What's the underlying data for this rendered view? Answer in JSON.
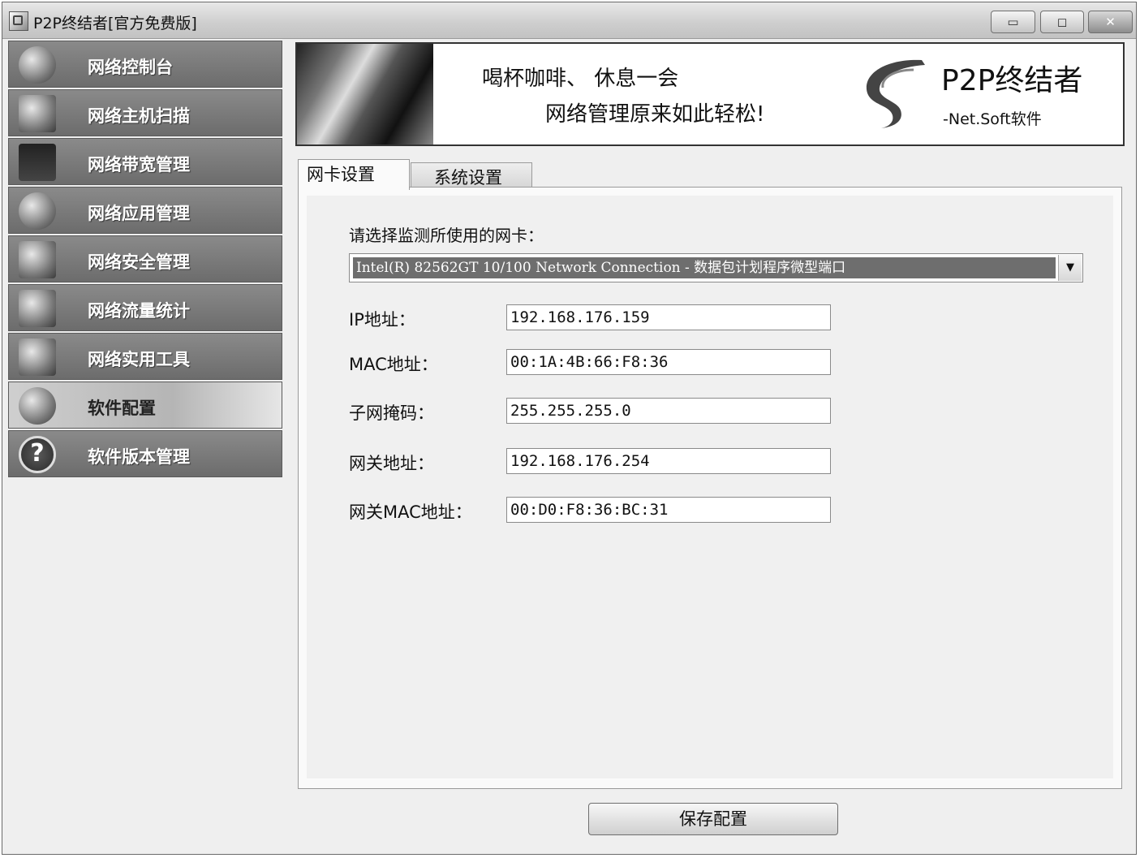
{
  "window": {
    "title": "P2P终结者[官方免费版]",
    "controls": {
      "minimize": "▭",
      "maximize": "◻",
      "close": "✕"
    }
  },
  "sidebar": {
    "items": [
      {
        "label": "网络控制台",
        "icon": "globe-icon",
        "active": false
      },
      {
        "label": "网络主机扫描",
        "icon": "computer-icon",
        "active": false
      },
      {
        "label": "网络带宽管理",
        "icon": "waveform-icon",
        "active": false
      },
      {
        "label": "网络应用管理",
        "icon": "apps-icon",
        "active": false
      },
      {
        "label": "网络安全管理",
        "icon": "keys-icon",
        "active": false
      },
      {
        "label": "网络流量统计",
        "icon": "books-icon",
        "active": false
      },
      {
        "label": "网络实用工具",
        "icon": "tools-icon",
        "active": false
      },
      {
        "label": "软件配置",
        "icon": "settings-globe-icon",
        "active": true
      },
      {
        "label": "软件版本管理",
        "icon": "help-icon",
        "active": false
      }
    ]
  },
  "banner": {
    "slogan_line1": "喝杯咖啡、  休息一会",
    "slogan_line2": "网络管理原来如此轻松!",
    "brand": "P2P终结者",
    "brand_sub": "-Net.Soft软件"
  },
  "tabs": [
    {
      "label": "网卡设置",
      "active": true
    },
    {
      "label": "系统设置",
      "active": false
    }
  ],
  "nic": {
    "prompt": "请选择监测所使用的网卡：",
    "selected": "Intel(R) 82562GT 10/100 Network Connection - 数据包计划程序微型端口",
    "dropdown_icon": "▼",
    "fields": [
      {
        "label": "IP地址：",
        "value": "192.168.176.159"
      },
      {
        "label": "MAC地址：",
        "value": "00:1A:4B:66:F8:36"
      },
      {
        "label": "子网掩码：",
        "value": "255.255.255.0"
      },
      {
        "label": "网关地址：",
        "value": "192.168.176.254"
      },
      {
        "label": "网关MAC地址：",
        "value": "00:D0:F8:36:BC:31"
      }
    ]
  },
  "save_button": "保存配置"
}
